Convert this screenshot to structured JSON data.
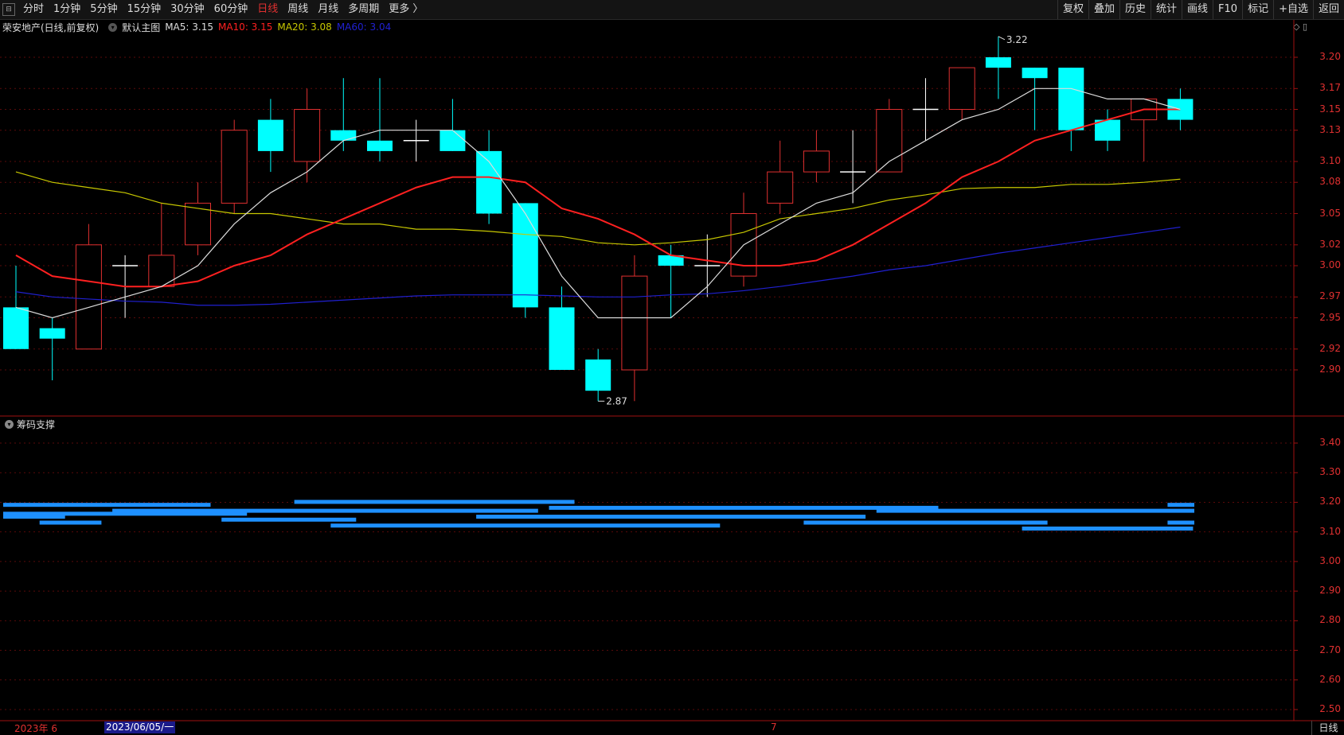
{
  "toolbar": {
    "tabs": [
      "分时",
      "1分钟",
      "5分钟",
      "15分钟",
      "30分钟",
      "60分钟",
      "日线",
      "周线",
      "月线",
      "多周期",
      "更多 〉"
    ],
    "active_tab": "日线",
    "right_buttons": [
      "复权",
      "叠加",
      "历史",
      "统计",
      "画线",
      "F10",
      "标记",
      "+自选",
      "返回"
    ]
  },
  "info": {
    "stock_name": "荣安地产(日线,前复权)",
    "template": "默认主图",
    "ma5": "MA5: 3.15",
    "ma10": "MA10: 3.15",
    "ma20": "MA20: 3.08",
    "ma60": "MA60: 3.04"
  },
  "subchart": {
    "title": "筹码支撑"
  },
  "bottom": {
    "date_label": "2023年 6",
    "cursor_date": "2023/06/05/一",
    "month_mark": "7",
    "period_tab": "日线"
  },
  "colors": {
    "up": "#e03030",
    "down": "#00ffff",
    "ma5": "#dddddd",
    "ma10": "#ff2020",
    "ma20": "#c8c800",
    "ma60": "#2020d0",
    "chip": "#1e90ff"
  },
  "chart_data": {
    "type": "candlestick",
    "main_y_ticks": [
      "3.20",
      "3.17",
      "3.15",
      "3.13",
      "3.10",
      "3.08",
      "3.05",
      "3.02",
      "3.00",
      "2.97",
      "2.95",
      "2.92",
      "2.90"
    ],
    "sub_y_ticks": [
      "3.40",
      "3.30",
      "3.20",
      "3.10",
      "3.00",
      "2.90",
      "2.80",
      "2.70",
      "2.60",
      "2.50"
    ],
    "high_annotation": "3.22",
    "low_annotation": "2.87",
    "candles": [
      {
        "o": 2.96,
        "h": 3.0,
        "l": 2.92,
        "c": 2.92
      },
      {
        "o": 2.94,
        "h": 2.95,
        "l": 2.89,
        "c": 2.93
      },
      {
        "o": 2.92,
        "h": 3.04,
        "l": 2.92,
        "c": 3.02
      },
      {
        "o": 3.0,
        "h": 3.01,
        "l": 2.95,
        "c": 3.0
      },
      {
        "o": 2.98,
        "h": 3.06,
        "l": 2.98,
        "c": 3.01
      },
      {
        "o": 3.02,
        "h": 3.08,
        "l": 3.01,
        "c": 3.06
      },
      {
        "o": 3.06,
        "h": 3.14,
        "l": 3.05,
        "c": 3.13
      },
      {
        "o": 3.14,
        "h": 3.16,
        "l": 3.09,
        "c": 3.11
      },
      {
        "o": 3.1,
        "h": 3.17,
        "l": 3.08,
        "c": 3.15
      },
      {
        "o": 3.13,
        "h": 3.18,
        "l": 3.11,
        "c": 3.12
      },
      {
        "o": 3.12,
        "h": 3.18,
        "l": 3.1,
        "c": 3.11
      },
      {
        "o": 3.12,
        "h": 3.14,
        "l": 3.1,
        "c": 3.12
      },
      {
        "o": 3.13,
        "h": 3.16,
        "l": 3.11,
        "c": 3.11
      },
      {
        "o": 3.11,
        "h": 3.13,
        "l": 3.04,
        "c": 3.05
      },
      {
        "o": 3.06,
        "h": 3.06,
        "l": 2.95,
        "c": 2.96
      },
      {
        "o": 2.96,
        "h": 2.98,
        "l": 2.9,
        "c": 2.9
      },
      {
        "o": 2.91,
        "h": 2.92,
        "l": 2.87,
        "c": 2.88
      },
      {
        "o": 2.9,
        "h": 3.01,
        "l": 2.87,
        "c": 2.99
      },
      {
        "o": 3.01,
        "h": 3.02,
        "l": 2.95,
        "c": 3.0
      },
      {
        "o": 3.0,
        "h": 3.03,
        "l": 2.97,
        "c": 3.0
      },
      {
        "o": 2.99,
        "h": 3.07,
        "l": 2.98,
        "c": 3.05
      },
      {
        "o": 3.06,
        "h": 3.12,
        "l": 3.05,
        "c": 3.09
      },
      {
        "o": 3.09,
        "h": 3.13,
        "l": 3.08,
        "c": 3.11
      },
      {
        "o": 3.09,
        "h": 3.13,
        "l": 3.06,
        "c": 3.09
      },
      {
        "o": 3.09,
        "h": 3.16,
        "l": 3.09,
        "c": 3.15
      },
      {
        "o": 3.15,
        "h": 3.18,
        "l": 3.12,
        "c": 3.15
      },
      {
        "o": 3.15,
        "h": 3.19,
        "l": 3.14,
        "c": 3.19
      },
      {
        "o": 3.2,
        "h": 3.22,
        "l": 3.16,
        "c": 3.19
      },
      {
        "o": 3.19,
        "h": 3.19,
        "l": 3.13,
        "c": 3.18
      },
      {
        "o": 3.19,
        "h": 3.19,
        "l": 3.11,
        "c": 3.13
      },
      {
        "o": 3.14,
        "h": 3.15,
        "l": 3.11,
        "c": 3.12
      },
      {
        "o": 3.14,
        "h": 3.16,
        "l": 3.1,
        "c": 3.16
      },
      {
        "o": 3.16,
        "h": 3.17,
        "l": 3.13,
        "c": 3.14
      }
    ],
    "ma5": [
      2.96,
      2.95,
      2.96,
      2.97,
      2.98,
      3.0,
      3.04,
      3.07,
      3.09,
      3.12,
      3.13,
      3.13,
      3.13,
      3.1,
      3.05,
      2.99,
      2.95,
      2.95,
      2.95,
      2.98,
      3.02,
      3.04,
      3.06,
      3.07,
      3.1,
      3.12,
      3.14,
      3.15,
      3.17,
      3.17,
      3.16,
      3.16,
      3.15
    ],
    "ma10": [
      3.01,
      2.99,
      2.985,
      2.98,
      2.98,
      2.985,
      3.0,
      3.01,
      3.03,
      3.045,
      3.06,
      3.075,
      3.085,
      3.085,
      3.08,
      3.055,
      3.045,
      3.03,
      3.01,
      3.005,
      3.0,
      3.0,
      3.005,
      3.02,
      3.04,
      3.06,
      3.085,
      3.1,
      3.12,
      3.13,
      3.14,
      3.15,
      3.15
    ],
    "ma20": [
      3.09,
      3.08,
      3.075,
      3.07,
      3.06,
      3.055,
      3.05,
      3.05,
      3.045,
      3.04,
      3.04,
      3.035,
      3.035,
      3.033,
      3.03,
      3.028,
      3.022,
      3.02,
      3.022,
      3.025,
      3.032,
      3.045,
      3.05,
      3.055,
      3.063,
      3.068,
      3.074,
      3.075,
      3.075,
      3.078,
      3.078,
      3.08,
      3.083
    ],
    "ma60": [
      2.975,
      2.97,
      2.968,
      2.966,
      2.965,
      2.962,
      2.962,
      2.963,
      2.965,
      2.967,
      2.969,
      2.971,
      2.972,
      2.972,
      2.972,
      2.971,
      2.97,
      2.97,
      2.972,
      2.973,
      2.976,
      2.98,
      2.985,
      2.99,
      2.996,
      3.0,
      3.006,
      3.012,
      3.017,
      3.022,
      3.027,
      3.032,
      3.037
    ],
    "chip_bars": [
      {
        "price": 3.19,
        "from": 0,
        "to": 5
      },
      {
        "price": 3.17,
        "from": 3,
        "to": 14
      },
      {
        "price": 3.16,
        "from": 0,
        "to": 6
      },
      {
        "price": 3.15,
        "from": 0,
        "to": 1
      },
      {
        "price": 3.14,
        "from": 6,
        "to": 9
      },
      {
        "price": 3.13,
        "from": 1,
        "to": 2
      },
      {
        "price": 3.12,
        "from": 9,
        "to": 19
      },
      {
        "price": 3.2,
        "from": 8,
        "to": 15
      },
      {
        "price": 3.18,
        "from": 15,
        "to": 25
      },
      {
        "price": 3.15,
        "from": 13,
        "to": 23
      },
      {
        "price": 3.17,
        "from": 24,
        "to": 42
      },
      {
        "price": 3.13,
        "from": 22,
        "to": 28
      },
      {
        "price": 3.11,
        "from": 28,
        "to": 32
      },
      {
        "price": 3.19,
        "from": 32,
        "to": 42
      },
      {
        "price": 3.13,
        "from": 32,
        "to": 42
      },
      {
        "price": 3.12,
        "from": 39,
        "to": 42
      }
    ]
  }
}
